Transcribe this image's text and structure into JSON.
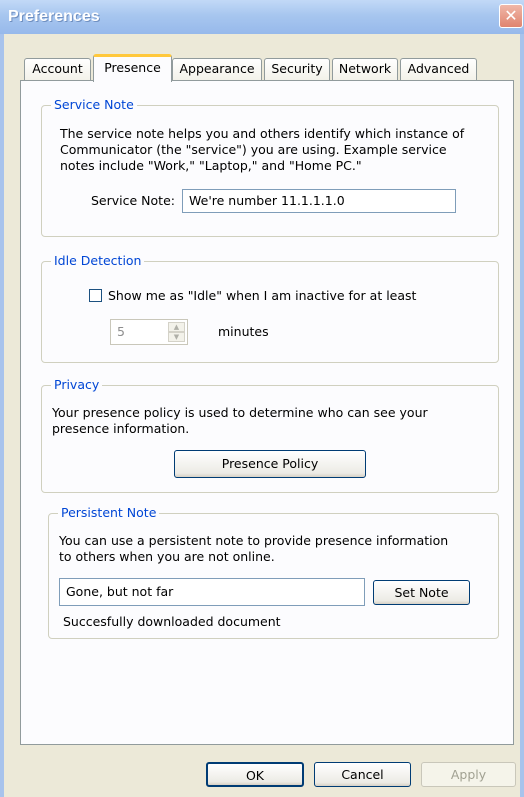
{
  "window": {
    "title": "Preferences",
    "close_glyph": "✕"
  },
  "tabs": [
    {
      "label": "Account"
    },
    {
      "label": "Presence"
    },
    {
      "label": "Appearance"
    },
    {
      "label": "Security"
    },
    {
      "label": "Network"
    },
    {
      "label": "Advanced"
    }
  ],
  "service_note": {
    "legend": "Service Note",
    "description_lines": [
      "The service note helps you and others identify which instance of",
      "Communicator (the \"service\") you are using.  Example service",
      "notes include \"Work,\" \"Laptop,\" and \"Home PC.\""
    ],
    "field_label": "Service Note:",
    "field_value": "We're number 11.1.1.1.0"
  },
  "idle_detection": {
    "legend": "Idle Detection",
    "checkbox_label": "Show me as \"Idle\" when I am inactive for at least",
    "checked": false,
    "minutes_value": "5",
    "minutes_label": "minutes"
  },
  "privacy": {
    "legend": "Privacy",
    "description_lines": [
      "Your presence policy is used to determine who can see your",
      "presence information."
    ],
    "button_label": "Presence Policy"
  },
  "persistent_note": {
    "legend": "Persistent Note",
    "description_lines": [
      "You can use a persistent note to provide presence information",
      "to others when you are not online."
    ],
    "note_value": "Gone, but not far",
    "set_note_label": "Set Note",
    "status_text": "Succesfully downloaded document"
  },
  "footer": {
    "ok_label": "OK",
    "cancel_label": "Cancel",
    "apply_label": "Apply"
  },
  "colors": {
    "legend": "#0046d5",
    "tab_highlight": "#ffc83c",
    "titlebar": "#a7c6ef"
  },
  "icons": {
    "close": "close-icon",
    "spin_up": "chevron-up-icon",
    "spin_down": "chevron-down-icon"
  }
}
